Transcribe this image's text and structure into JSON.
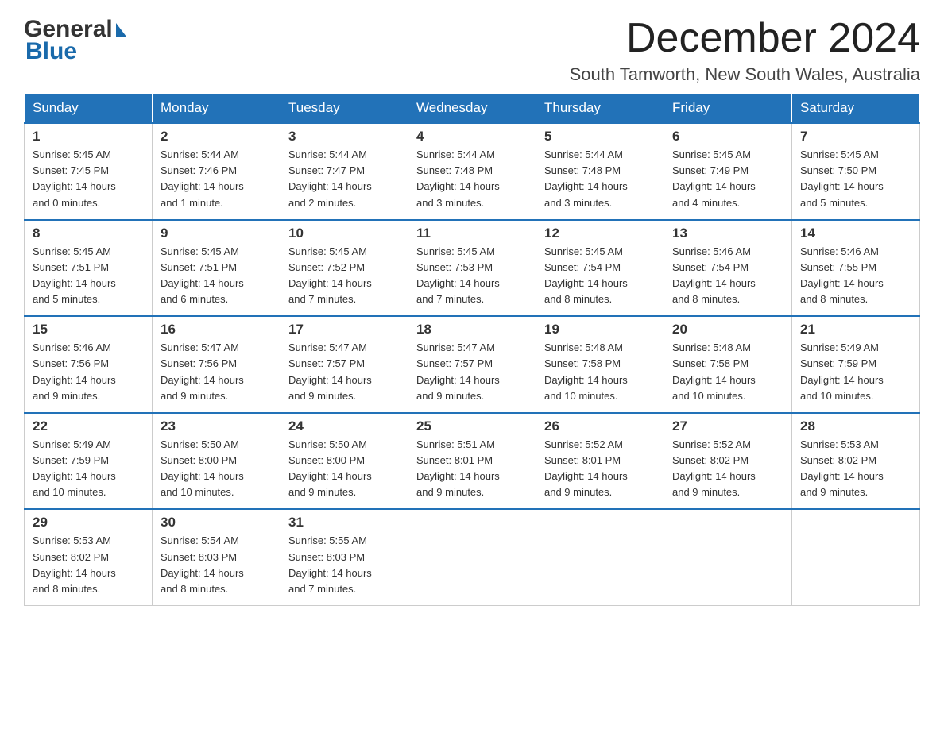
{
  "header": {
    "month_title": "December 2024",
    "location": "South Tamworth, New South Wales, Australia",
    "logo_general": "General",
    "logo_blue": "Blue"
  },
  "columns": [
    "Sunday",
    "Monday",
    "Tuesday",
    "Wednesday",
    "Thursday",
    "Friday",
    "Saturday"
  ],
  "weeks": [
    [
      {
        "day": "1",
        "sunrise": "5:45 AM",
        "sunset": "7:45 PM",
        "daylight": "14 hours and 0 minutes."
      },
      {
        "day": "2",
        "sunrise": "5:44 AM",
        "sunset": "7:46 PM",
        "daylight": "14 hours and 1 minute."
      },
      {
        "day": "3",
        "sunrise": "5:44 AM",
        "sunset": "7:47 PM",
        "daylight": "14 hours and 2 minutes."
      },
      {
        "day": "4",
        "sunrise": "5:44 AM",
        "sunset": "7:48 PM",
        "daylight": "14 hours and 3 minutes."
      },
      {
        "day": "5",
        "sunrise": "5:44 AM",
        "sunset": "7:48 PM",
        "daylight": "14 hours and 3 minutes."
      },
      {
        "day": "6",
        "sunrise": "5:45 AM",
        "sunset": "7:49 PM",
        "daylight": "14 hours and 4 minutes."
      },
      {
        "day": "7",
        "sunrise": "5:45 AM",
        "sunset": "7:50 PM",
        "daylight": "14 hours and 5 minutes."
      }
    ],
    [
      {
        "day": "8",
        "sunrise": "5:45 AM",
        "sunset": "7:51 PM",
        "daylight": "14 hours and 5 minutes."
      },
      {
        "day": "9",
        "sunrise": "5:45 AM",
        "sunset": "7:51 PM",
        "daylight": "14 hours and 6 minutes."
      },
      {
        "day": "10",
        "sunrise": "5:45 AM",
        "sunset": "7:52 PM",
        "daylight": "14 hours and 7 minutes."
      },
      {
        "day": "11",
        "sunrise": "5:45 AM",
        "sunset": "7:53 PM",
        "daylight": "14 hours and 7 minutes."
      },
      {
        "day": "12",
        "sunrise": "5:45 AM",
        "sunset": "7:54 PM",
        "daylight": "14 hours and 8 minutes."
      },
      {
        "day": "13",
        "sunrise": "5:46 AM",
        "sunset": "7:54 PM",
        "daylight": "14 hours and 8 minutes."
      },
      {
        "day": "14",
        "sunrise": "5:46 AM",
        "sunset": "7:55 PM",
        "daylight": "14 hours and 8 minutes."
      }
    ],
    [
      {
        "day": "15",
        "sunrise": "5:46 AM",
        "sunset": "7:56 PM",
        "daylight": "14 hours and 9 minutes."
      },
      {
        "day": "16",
        "sunrise": "5:47 AM",
        "sunset": "7:56 PM",
        "daylight": "14 hours and 9 minutes."
      },
      {
        "day": "17",
        "sunrise": "5:47 AM",
        "sunset": "7:57 PM",
        "daylight": "14 hours and 9 minutes."
      },
      {
        "day": "18",
        "sunrise": "5:47 AM",
        "sunset": "7:57 PM",
        "daylight": "14 hours and 9 minutes."
      },
      {
        "day": "19",
        "sunrise": "5:48 AM",
        "sunset": "7:58 PM",
        "daylight": "14 hours and 10 minutes."
      },
      {
        "day": "20",
        "sunrise": "5:48 AM",
        "sunset": "7:58 PM",
        "daylight": "14 hours and 10 minutes."
      },
      {
        "day": "21",
        "sunrise": "5:49 AM",
        "sunset": "7:59 PM",
        "daylight": "14 hours and 10 minutes."
      }
    ],
    [
      {
        "day": "22",
        "sunrise": "5:49 AM",
        "sunset": "7:59 PM",
        "daylight": "14 hours and 10 minutes."
      },
      {
        "day": "23",
        "sunrise": "5:50 AM",
        "sunset": "8:00 PM",
        "daylight": "14 hours and 10 minutes."
      },
      {
        "day": "24",
        "sunrise": "5:50 AM",
        "sunset": "8:00 PM",
        "daylight": "14 hours and 9 minutes."
      },
      {
        "day": "25",
        "sunrise": "5:51 AM",
        "sunset": "8:01 PM",
        "daylight": "14 hours and 9 minutes."
      },
      {
        "day": "26",
        "sunrise": "5:52 AM",
        "sunset": "8:01 PM",
        "daylight": "14 hours and 9 minutes."
      },
      {
        "day": "27",
        "sunrise": "5:52 AM",
        "sunset": "8:02 PM",
        "daylight": "14 hours and 9 minutes."
      },
      {
        "day": "28",
        "sunrise": "5:53 AM",
        "sunset": "8:02 PM",
        "daylight": "14 hours and 9 minutes."
      }
    ],
    [
      {
        "day": "29",
        "sunrise": "5:53 AM",
        "sunset": "8:02 PM",
        "daylight": "14 hours and 8 minutes."
      },
      {
        "day": "30",
        "sunrise": "5:54 AM",
        "sunset": "8:03 PM",
        "daylight": "14 hours and 8 minutes."
      },
      {
        "day": "31",
        "sunrise": "5:55 AM",
        "sunset": "8:03 PM",
        "daylight": "14 hours and 7 minutes."
      },
      null,
      null,
      null,
      null
    ]
  ],
  "labels": {
    "sunrise": "Sunrise:",
    "sunset": "Sunset:",
    "daylight": "Daylight:"
  }
}
